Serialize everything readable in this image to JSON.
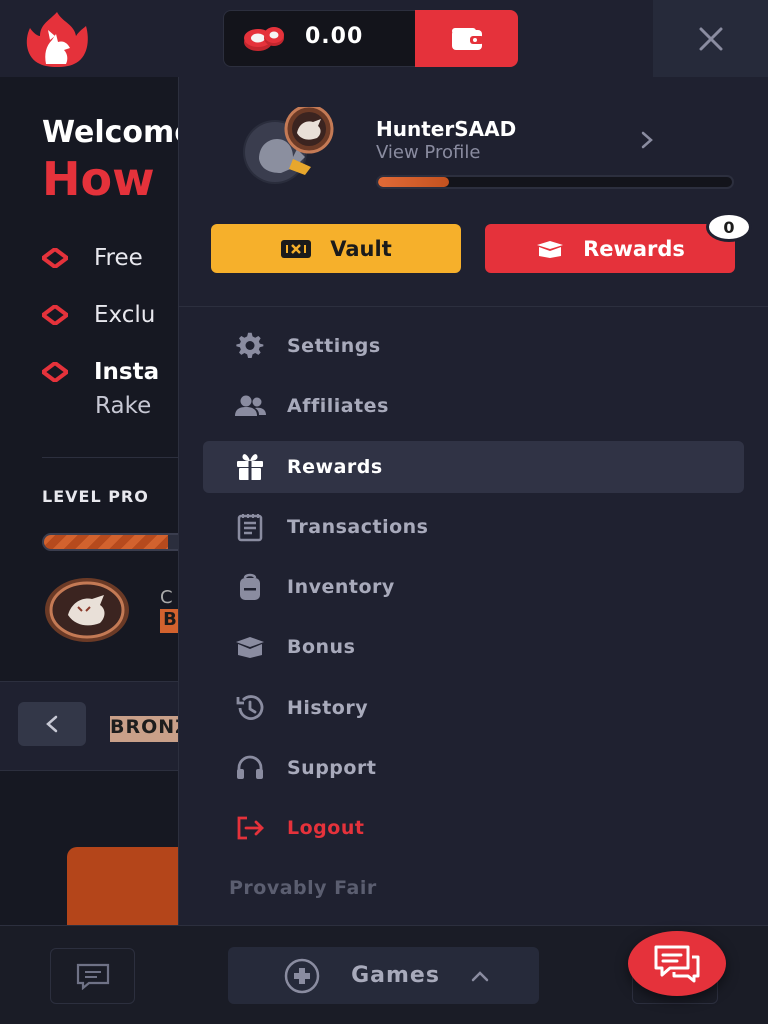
{
  "topbar": {
    "balance": "0.00",
    "logo_icon": "flame-wolf-logo",
    "chips_icon": "poker-chips-icon",
    "wallet_icon": "wallet-icon",
    "close_icon": "close-icon"
  },
  "background": {
    "welcome": "Welcome",
    "how": "How",
    "bullets": [
      "Free",
      "Exclu",
      "Insta"
    ],
    "rake": "Rake",
    "level_progress": "LEVEL PRO",
    "level_progress_fraction": 0.85,
    "tier_initial": "B",
    "tier_top": "C",
    "bronze": "BRONZE"
  },
  "profile": {
    "username": "HunterSAAD",
    "view_profile": "View Profile",
    "xp_fraction": 0.2
  },
  "actions": {
    "vault_label": "Vault",
    "rewards_label": "Rewards",
    "rewards_count": "0"
  },
  "menu": {
    "items": [
      {
        "label": "Settings",
        "icon": "gear-icon"
      },
      {
        "label": "Affiliates",
        "icon": "users-icon"
      },
      {
        "label": "Rewards",
        "icon": "gift-icon",
        "active": true
      },
      {
        "label": "Transactions",
        "icon": "receipt-icon"
      },
      {
        "label": "Inventory",
        "icon": "backpack-icon"
      },
      {
        "label": "Bonus",
        "icon": "box-icon"
      },
      {
        "label": "History",
        "icon": "history-icon"
      },
      {
        "label": "Support",
        "icon": "headset-icon"
      },
      {
        "label": "Logout",
        "icon": "logout-icon"
      }
    ],
    "provably_fair": "Provably Fair"
  },
  "bottombar": {
    "games_label": "Games"
  },
  "colors": {
    "accent_red": "#e5323b",
    "vault_yellow": "#f6b02b",
    "panel": "#1f2130",
    "xp_orange": "#e06a37"
  }
}
